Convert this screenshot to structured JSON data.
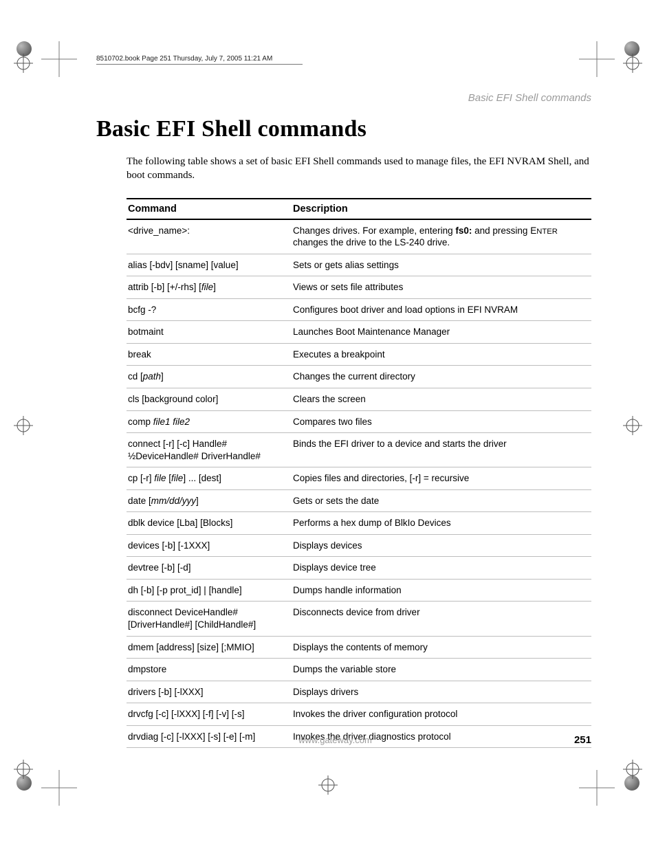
{
  "meta": {
    "bookline": "8510702.book  Page 251  Thursday, July 7, 2005  11:21 AM",
    "running_head": "Basic EFI Shell commands",
    "title": "Basic EFI Shell commands",
    "intro": "The following table shows a set of basic EFI Shell commands used to manage files, the EFI NVRAM Shell, and boot commands.",
    "footer_url": "www.gateway.com",
    "page_number": "251"
  },
  "table": {
    "headers": {
      "command": "Command",
      "description": "Description"
    },
    "rows": [
      {
        "command_html": "&lt;drive_name&gt;:",
        "description_html": "Changes drives. For example, entering <b>fs0:</b> and pressing <span class='smallcaps'>E<small>NTER</small></span> changes the drive to the LS-240 drive."
      },
      {
        "command_html": "alias [-bdv] [sname] [value]",
        "description_html": "Sets or gets alias settings"
      },
      {
        "command_html": "attrib [-b] [+/-rhs] [<span class='ital'>file</span>]",
        "description_html": "Views or sets file attributes"
      },
      {
        "command_html": "bcfg -?",
        "description_html": "Configures boot driver and load options in EFI NVRAM"
      },
      {
        "command_html": "botmaint",
        "description_html": "Launches Boot Maintenance Manager"
      },
      {
        "command_html": "break",
        "description_html": "Executes a breakpoint"
      },
      {
        "command_html": "cd [<span class='ital'>path</span>]",
        "description_html": "Changes the current directory"
      },
      {
        "command_html": "cls [background color]",
        "description_html": "Clears the screen"
      },
      {
        "command_html": "comp <span class='ital'>file1 file2</span>",
        "description_html": "Compares two files"
      },
      {
        "command_html": "connect [-r] [-c] Handle# ½DeviceHandle# DriverHandle#",
        "description_html": "Binds the EFI driver to a device and starts the driver"
      },
      {
        "command_html": "cp [-r] <span class='ital'>file</span> [<span class='ital'>file</span>] ... [dest]",
        "description_html": "Copies files and directories, [-r] = recursive"
      },
      {
        "command_html": "date [<span class='ital'>mm/dd/yyy</span>]",
        "description_html": "Gets or sets the date"
      },
      {
        "command_html": "dblk device [Lba] [Blocks]",
        "description_html": "Performs a hex dump of BlkIo Devices"
      },
      {
        "command_html": "devices [-b] [-1XXX]",
        "description_html": "Displays devices"
      },
      {
        "command_html": "devtree [-b] [-d]",
        "description_html": "Displays device tree"
      },
      {
        "command_html": "dh [-b] [-p prot_id] | [handle]",
        "description_html": "Dumps handle information"
      },
      {
        "command_html": "disconnect DeviceHandle# [DriverHandle#] [ChildHandle#]",
        "description_html": "Disconnects device from driver"
      },
      {
        "command_html": "dmem [address] [size] [;MMIO]",
        "description_html": "Displays the contents of memory"
      },
      {
        "command_html": "dmpstore",
        "description_html": "Dumps the variable store"
      },
      {
        "command_html": "drivers [-b] [-lXXX]",
        "description_html": "Displays drivers"
      },
      {
        "command_html": "drvcfg [-c] [-lXXX] [-f] [-v] [-s]",
        "description_html": "Invokes the driver configuration protocol"
      },
      {
        "command_html": "drvdiag [-c] [-lXXX] [-s] [-e] [-m]",
        "description_html": "Invokes the driver diagnostics protocol"
      }
    ]
  }
}
